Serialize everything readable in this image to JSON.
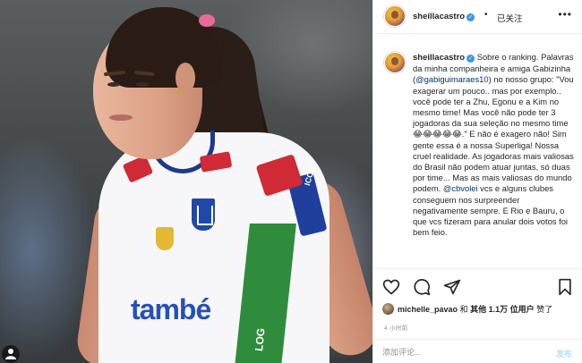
{
  "photo": {
    "brand_text": "també",
    "sleeve_text": "ICONY",
    "green_text": "LOG"
  },
  "header": {
    "username": "sheillacastro",
    "verified_mark": "✓",
    "separator": "•",
    "follow_status": "已关注",
    "more_icon": "•••"
  },
  "caption": {
    "username": "sheillacastro",
    "verified_mark": "✓",
    "text_part1": " Sobre o ranking. Palavras da minha companheira e amiga Gabizinha (",
    "mention1": "@gabiguimaraes10",
    "text_part2": ") no nosso grupo: \"Vou exagerar um pouco.. mas por exemplo.. você pode ter a Zhu, Egonu e a Kim no mesmo time! Mas você não pode ter 3 jogadoras da sua seleção no mesmo time 😂😂😂😂😂.\" E não é exagero não! Sim gente essa é a nossa Superliga! Nossa cruel realidade. As jogadoras mais valiosas do Brasil não podem atuar juntas, só duas por time... Mas as mais valiosas do mundo podem. ",
    "mention2": "@cbvolei",
    "text_part3": " vcs e alguns clubes conseguem nos surpreender negativamente sempre. E Rio e Bauru, o que vcs fizeram para anular dois votos foi bem feio."
  },
  "actions": {
    "like_icon": "heart-icon",
    "comment_icon": "comment-icon",
    "share_icon": "share-icon",
    "save_icon": "bookmark-icon"
  },
  "likes": {
    "first_liker": "michelle_pavao",
    "and_text": "和",
    "others_text": "其他 1.1万 位用户",
    "liked_text": "赞了"
  },
  "timestamp": "4 小时前",
  "comment": {
    "placeholder": "添加评论...",
    "post_label": "发布"
  }
}
